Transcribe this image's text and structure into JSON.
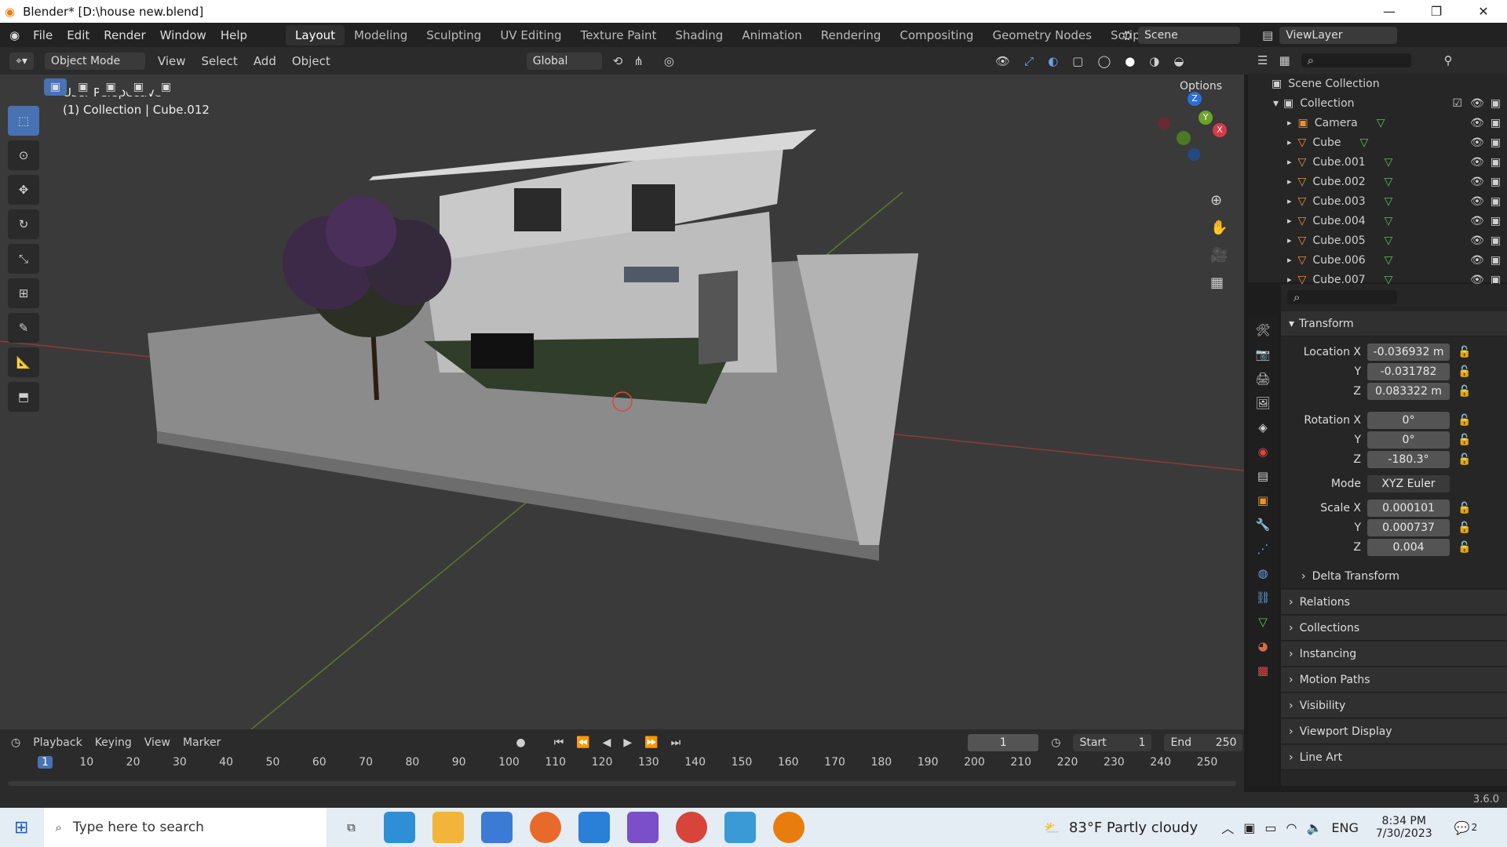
{
  "window": {
    "title": "Blender* [D:\\house new.blend]"
  },
  "menus": [
    "File",
    "Edit",
    "Render",
    "Window",
    "Help"
  ],
  "workspaces": [
    "Layout",
    "Modeling",
    "Sculpting",
    "UV Editing",
    "Texture Paint",
    "Shading",
    "Animation",
    "Rendering",
    "Compositing",
    "Geometry Nodes",
    "Scripting"
  ],
  "active_workspace": "Layout",
  "scene": {
    "name": "Scene",
    "view_layer": "ViewLayer"
  },
  "header": {
    "mode": "Object Mode",
    "view": "View",
    "select": "Select",
    "add": "Add",
    "object": "Object",
    "orientation": "Global",
    "options": "Options"
  },
  "viewport": {
    "perspective": "User Perspective",
    "selection": "(1) Collection | Cube.012"
  },
  "outliner": {
    "root": "Scene Collection",
    "collection": "Collection",
    "items": [
      "Camera",
      "Cube",
      "Cube.001",
      "Cube.002",
      "Cube.003",
      "Cube.004",
      "Cube.005",
      "Cube.006",
      "Cube.007"
    ]
  },
  "properties": {
    "transform": "Transform",
    "location_label": "Location X",
    "loc": {
      "x": "-0.036932 m",
      "y": "-0.031782",
      "z": "0.083322 m"
    },
    "rotation_label": "Rotation X",
    "rot": {
      "x": "0°",
      "y": "0°",
      "z": "-180.3°"
    },
    "mode_label": "Mode",
    "mode": "XYZ Euler",
    "scale_label": "Scale X",
    "scale": {
      "x": "0.000101",
      "y": "0.000737",
      "z": "0.004"
    },
    "y": "Y",
    "z": "Z",
    "panels": [
      "Delta Transform",
      "Relations",
      "Collections",
      "Instancing",
      "Motion Paths",
      "Visibility",
      "Viewport Display",
      "Line Art"
    ]
  },
  "timeline": {
    "playback": "Playback",
    "keying": "Keying",
    "view": "View",
    "marker": "Marker",
    "current": "1",
    "start_label": "Start",
    "start": "1",
    "end_label": "End",
    "end": "250",
    "ticks": [
      "1",
      "10",
      "20",
      "30",
      "40",
      "50",
      "60",
      "70",
      "80",
      "90",
      "100",
      "110",
      "120",
      "130",
      "140",
      "150",
      "160",
      "170",
      "180",
      "190",
      "200",
      "210",
      "220",
      "230",
      "240",
      "250"
    ]
  },
  "status": {
    "version": "3.6.0"
  },
  "taskbar": {
    "search": "Type here to search",
    "weather": "83°F  Partly cloudy",
    "lang": "ENG",
    "time": "8:34 PM",
    "date": "7/30/2023",
    "notif": "2"
  }
}
